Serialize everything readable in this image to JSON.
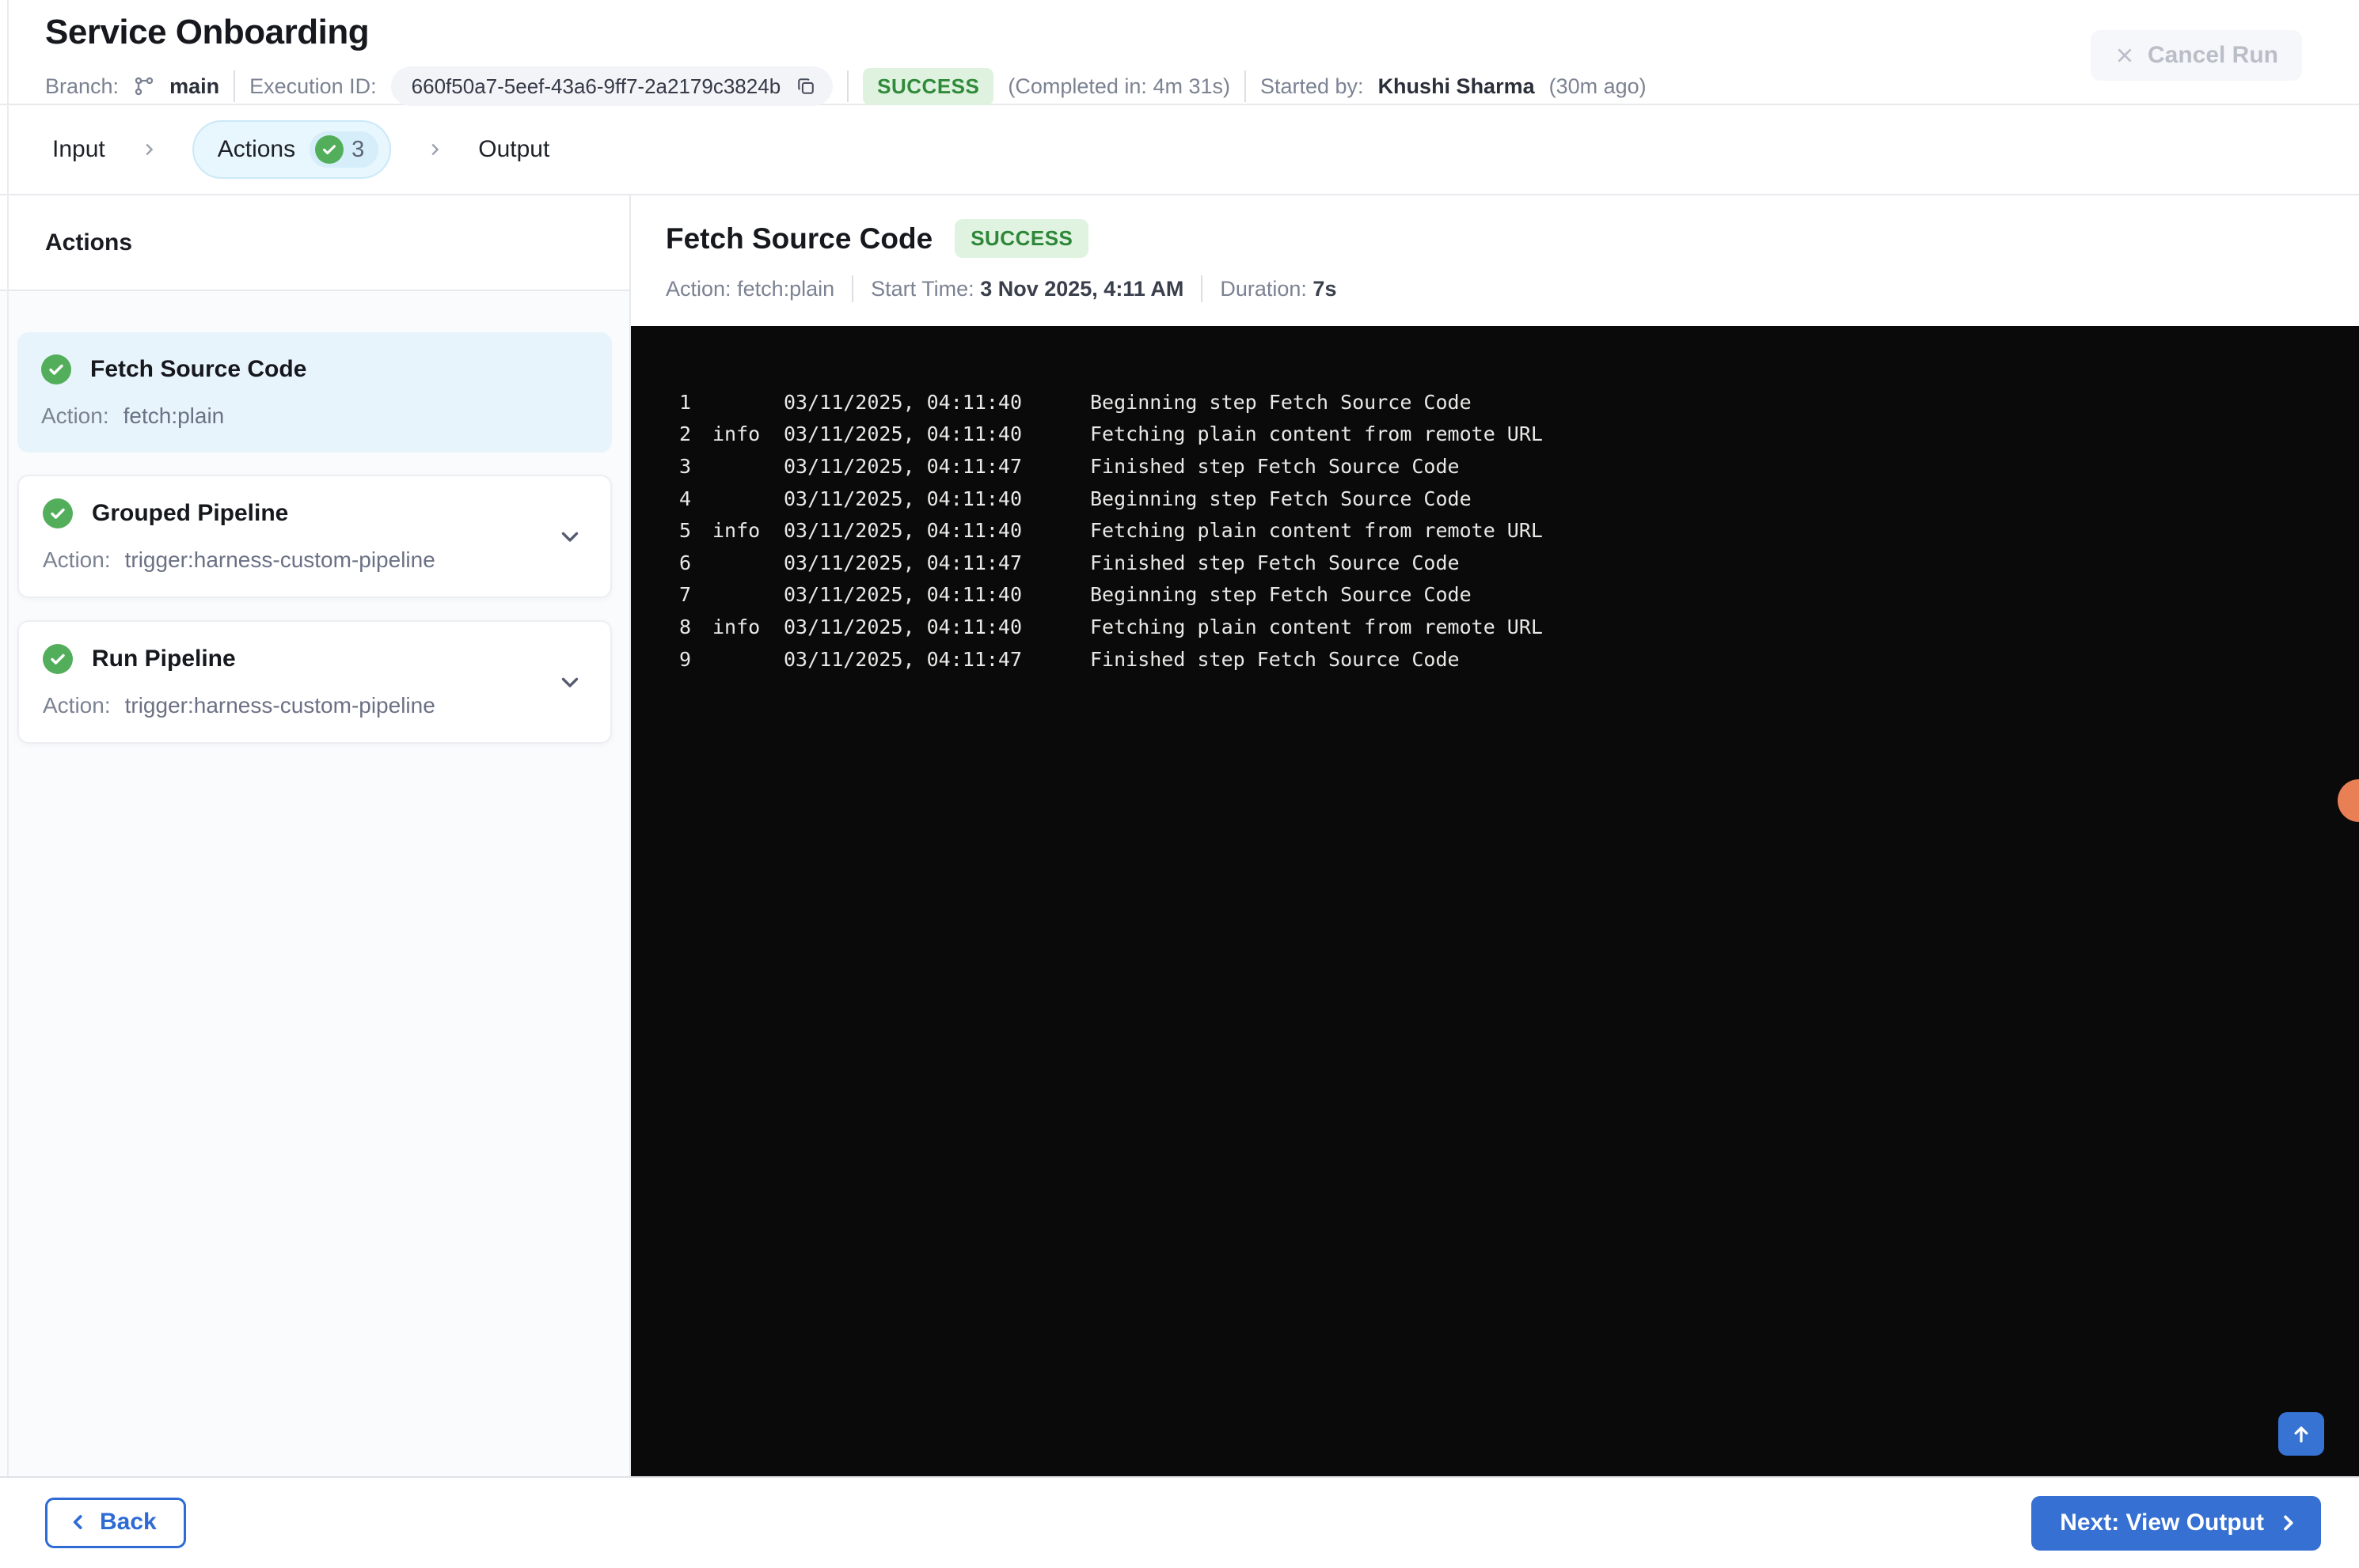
{
  "header": {
    "title": "Service Onboarding",
    "branch_label": "Branch:",
    "branch": "main",
    "execution_id_label": "Execution ID:",
    "execution_id": "660f50a7-5eef-43a6-9ff7-2a2179c3824b",
    "status": "SUCCESS",
    "completed_in": "(Completed in: 4m 31s)",
    "started_by_label": "Started by:",
    "started_by": "Khushi Sharma",
    "started_ago": "(30m ago)",
    "cancel_button": "Cancel Run"
  },
  "stepper": {
    "tabs": [
      {
        "label": "Input"
      },
      {
        "label": "Actions",
        "count": "3",
        "active": true
      },
      {
        "label": "Output"
      }
    ]
  },
  "sidebar": {
    "heading": "Actions",
    "items": [
      {
        "title": "Fetch Source Code",
        "action_label": "Action:",
        "action": "fetch:plain",
        "selected": true,
        "expandable": false
      },
      {
        "title": "Grouped Pipeline",
        "action_label": "Action:",
        "action": "trigger:harness-custom-pipeline",
        "selected": false,
        "expandable": true
      },
      {
        "title": "Run Pipeline",
        "action_label": "Action:",
        "action": "trigger:harness-custom-pipeline",
        "selected": false,
        "expandable": true
      }
    ]
  },
  "detail": {
    "title": "Fetch Source Code",
    "status": "SUCCESS",
    "action_label": "Action:",
    "action": "fetch:plain",
    "start_time_label": "Start Time:",
    "start_time": "3 Nov 2025, 4:11 AM",
    "duration_label": "Duration:",
    "duration": "7s"
  },
  "log": {
    "lines": [
      {
        "num": "1",
        "level": "",
        "time": "03/11/2025, 04:11:40",
        "message": "Beginning step Fetch Source Code"
      },
      {
        "num": "2",
        "level": "info",
        "time": "03/11/2025, 04:11:40",
        "message": "Fetching plain content from remote URL"
      },
      {
        "num": "3",
        "level": "",
        "time": "03/11/2025, 04:11:47",
        "message": "Finished step Fetch Source Code"
      },
      {
        "num": "4",
        "level": "",
        "time": "03/11/2025, 04:11:40",
        "message": "Beginning step Fetch Source Code"
      },
      {
        "num": "5",
        "level": "info",
        "time": "03/11/2025, 04:11:40",
        "message": "Fetching plain content from remote URL"
      },
      {
        "num": "6",
        "level": "",
        "time": "03/11/2025, 04:11:47",
        "message": "Finished step Fetch Source Code"
      },
      {
        "num": "7",
        "level": "",
        "time": "03/11/2025, 04:11:40",
        "message": "Beginning step Fetch Source Code"
      },
      {
        "num": "8",
        "level": "info",
        "time": "03/11/2025, 04:11:40",
        "message": "Fetching plain content from remote URL"
      },
      {
        "num": "9",
        "level": "",
        "time": "03/11/2025, 04:11:47",
        "message": "Finished step Fetch Source Code"
      }
    ]
  },
  "footer": {
    "back_label": "Back",
    "next_label": "Next: View Output"
  },
  "icons": {
    "branch": "git-branch-icon",
    "copy": "copy-icon",
    "close": "close-icon",
    "check": "check-circle-icon",
    "chevron_right": "chevron-right-icon",
    "chevron_down": "chevron-down-icon",
    "chevron_left": "chevron-left-icon",
    "arrow_up": "arrow-up-icon"
  },
  "colors": {
    "accent": "#3570d2",
    "success_text": "#2e8738",
    "success_bg": "#e0f3e1",
    "check_green": "#53ae5b",
    "log_background": "#0a0a0b",
    "selected_card": "#e8f4fb",
    "stepper_active_bg": "#e8f6fd",
    "orange_marker": "#e97f55"
  }
}
